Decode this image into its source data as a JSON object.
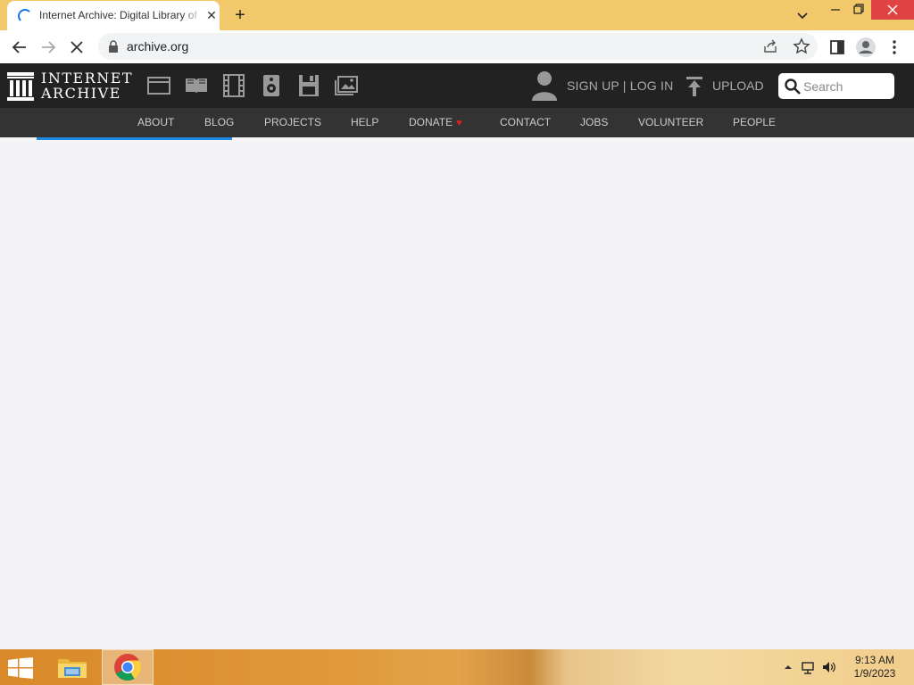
{
  "browser": {
    "tab_title": "Internet Archive: Digital Library of Free & Borrowable Books, Movies, Music & Wayback Machine",
    "tab_close": "✕",
    "new_tab": "+",
    "url": "archive.org",
    "window_controls": {
      "minimize": "—",
      "maximize": "❐",
      "close": "✕",
      "tab_search": "⌄"
    }
  },
  "ia": {
    "logo_line1": "INTERNET",
    "logo_line2": "ARCHIVE",
    "media_icons": [
      "web-icon",
      "texts-icon",
      "video-icon",
      "audio-icon",
      "software-icon",
      "images-icon"
    ],
    "signup": "SIGN UP | LOG IN",
    "upload": "UPLOAD",
    "search_placeholder": "Search",
    "subnav": [
      "ABOUT",
      "BLOG",
      "PROJECTS",
      "HELP",
      "DONATE",
      "CONTACT",
      "JOBS",
      "VOLUNTEER",
      "PEOPLE"
    ],
    "donate_heart": "♥"
  },
  "taskbar": {
    "time": "9:13 AM",
    "date": "1/9/2023"
  },
  "colors": {
    "tabstrip": "#f1c86a",
    "ia_top": "#222222",
    "ia_sub": "#333333",
    "progress": "#1e88e5",
    "heart": "#e01e1e"
  }
}
